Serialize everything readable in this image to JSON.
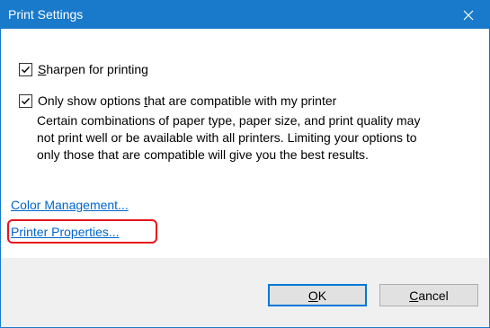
{
  "window": {
    "title": "Print Settings"
  },
  "options": {
    "sharpen": {
      "checked": true,
      "label_mnemonic": "S",
      "label_rest": "harpen for printing"
    },
    "compatible": {
      "checked": true,
      "label_pre": "Only show options ",
      "label_mnemonic": "t",
      "label_post": "hat are compatible with my printer",
      "description_lines": [
        "Certain combinations of paper type, paper size, and print quality may",
        "not print well or be available with all printers.  Limiting your options to",
        "only those that are compatible will give you the best results."
      ]
    }
  },
  "links": {
    "color_management": "Color Management...",
    "printer_properties": "Printer Properties..."
  },
  "buttons": {
    "ok_mnemonic": "O",
    "ok_rest": "K",
    "cancel_mnemonic": "C",
    "cancel_rest": "ancel"
  },
  "colors": {
    "titlebar": "#1979ca",
    "link": "#0066cc",
    "highlight": "#e8141c"
  }
}
